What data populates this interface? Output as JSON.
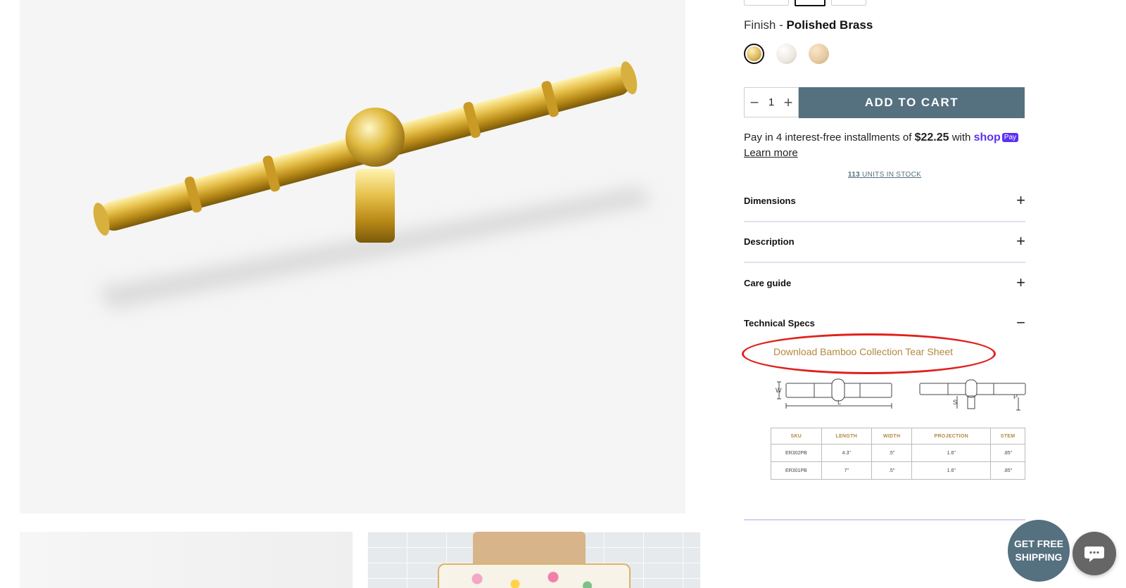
{
  "finish": {
    "label": "Finish - ",
    "value": "Polished Brass"
  },
  "finish_swatches": [
    {
      "name": "Polished Brass",
      "color": "#d9b45a",
      "selected": true
    },
    {
      "name": "Polished Nickel",
      "color": "#ece8e0",
      "selected": false
    },
    {
      "name": "Satin Brass",
      "color": "#e6c9a0",
      "selected": false
    }
  ],
  "quantity": {
    "value": "1",
    "minus": "−",
    "plus": "+"
  },
  "add_to_cart": "ADD TO CART",
  "installments": {
    "prefix": "Pay in 4 interest-free installments of ",
    "amount": "$22.25",
    "suffix": " with ",
    "shop": "shop",
    "pay_badge": "Pay",
    "learn_more": "Learn more"
  },
  "stock": {
    "count": "113",
    "label": " UNITS IN STOCK"
  },
  "accordion": [
    {
      "title": "Dimensions",
      "icon": "+"
    },
    {
      "title": "Description",
      "icon": "+"
    },
    {
      "title": "Care guide",
      "icon": "+"
    },
    {
      "title": "Technical Specs",
      "icon": "−"
    }
  ],
  "download_link": "Download Bamboo Collection Tear Sheet",
  "spec_labels": {
    "w": "W",
    "l": "L",
    "s": "S",
    "p": "P"
  },
  "spec_table": {
    "headers": [
      "SKU",
      "LENGTH",
      "WIDTH",
      "PROJECTION",
      "STEM"
    ],
    "rows": [
      [
        "ER302PB",
        "4.3\"",
        ".5\"",
        "1.6\"",
        ".85\""
      ],
      [
        "ER301PB",
        "7\"",
        ".5\"",
        "1.6\"",
        ".85\""
      ]
    ]
  },
  "free_shipping": {
    "line1": "GET FREE",
    "line2": "SHIPPING"
  },
  "colors": {
    "accent": "#55707f",
    "gold_text": "#b3893f",
    "annotation_red": "#e0201b"
  }
}
